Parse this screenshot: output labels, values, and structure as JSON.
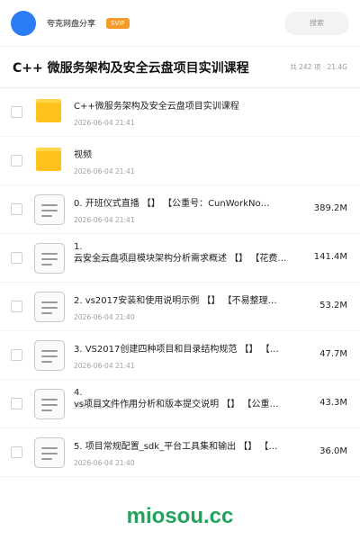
{
  "header": {
    "user_name": "夸克网盘分享",
    "badge": "SVIP",
    "search_placeholder": "搜索"
  },
  "folder": {
    "title": "C++ 微服务架构及安全云盘项目实训课程",
    "summary": "共 242 项 · 21.4G"
  },
  "files": [
    {
      "type": "folder",
      "name": "C++微服务架构及安全云盘项目实训课程",
      "name_line2": "",
      "date": "2026-06-04 21:41",
      "size": "",
      "icon": "folder-icon"
    },
    {
      "type": "folder",
      "name": "视频",
      "name_line2": "",
      "date": "2026-06-04 21:41",
      "size": "",
      "icon": "folder-icon"
    },
    {
      "type": "file",
      "name": "0. 开班仪式直播 【】 【公重号：CunWorkNo…",
      "name_line2": "",
      "date": "2026-06-04 21:41",
      "size": "389.2M",
      "icon": "document-icon"
    },
    {
      "type": "file",
      "name": "1.",
      "name_line2": "云安全云盘项目模块架构分析需求概述 【】 【花费…",
      "date": "2026-06-04 21:41",
      "size": "141.4M",
      "icon": "document-icon"
    },
    {
      "type": "file",
      "name": "2. vs2017安装和使用说明示例 【】 【不易整理…",
      "name_line2": "",
      "date": "2026-06-04 21:40",
      "size": "53.2M",
      "icon": "document-icon"
    },
    {
      "type": "file",
      "name": "3. VS2017创建四种项目和目录结构规范 【】 【…",
      "name_line2": "",
      "date": "2026-06-04 21:41",
      "size": "47.7M",
      "icon": "document-icon"
    },
    {
      "type": "file",
      "name": "4.",
      "name_line2": "vs项目文件作用分析和版本提交说明 【】 【公重…",
      "date": "2026-06-04 21:40",
      "size": "43.3M",
      "icon": "document-icon"
    },
    {
      "type": "file",
      "name": "5. 项目常规配置_sdk_平台工具集和输出 【】 【…",
      "name_line2": "",
      "date": "2026-06-04 21:40",
      "size": "36.0M",
      "icon": "document-icon"
    }
  ],
  "watermark": "miosou.cc"
}
